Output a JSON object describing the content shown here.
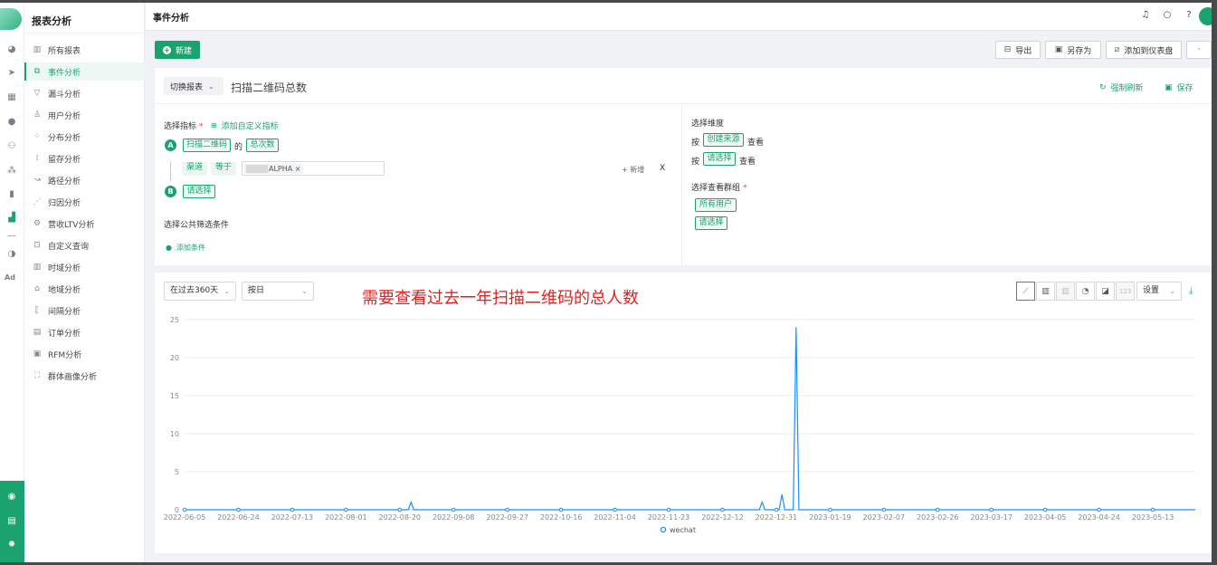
{
  "menu": {
    "title": "报表分析",
    "items": [
      {
        "label": "所有报表",
        "icon": "bar-chart-icon"
      },
      {
        "label": "事件分析",
        "icon": "event-icon"
      },
      {
        "label": "漏斗分析",
        "icon": "funnel-icon"
      },
      {
        "label": "用户分析",
        "icon": "user-icon"
      },
      {
        "label": "分布分析",
        "icon": "distribution-icon"
      },
      {
        "label": "留存分析",
        "icon": "retention-icon"
      },
      {
        "label": "路径分析",
        "icon": "path-icon"
      },
      {
        "label": "归因分析",
        "icon": "attribution-icon"
      },
      {
        "label": "营收LTV分析",
        "icon": "revenue-icon"
      },
      {
        "label": "自定义查询",
        "icon": "custom-query-icon"
      },
      {
        "label": "时域分析",
        "icon": "time-icon"
      },
      {
        "label": "地域分析",
        "icon": "map-icon"
      },
      {
        "label": "间隔分析",
        "icon": "interval-icon"
      },
      {
        "label": "订单分析",
        "icon": "order-icon"
      },
      {
        "label": "RFM分析",
        "icon": "rfm-icon"
      },
      {
        "label": "群体画像分析",
        "icon": "persona-icon"
      }
    ]
  },
  "rail": {
    "text_item": "Ad"
  },
  "topbar": {
    "title": "事件分析"
  },
  "toolbar": {
    "new_label": "新建",
    "export_label": "导出",
    "save_as_label": "另存为",
    "add_dashboard_label": "添加到仪表盘"
  },
  "query": {
    "switch_label": "切换报表",
    "report_title": "扫描二维码总数",
    "force_refresh": "强制刷新",
    "save": "保存",
    "select_metric_label": "选择指标",
    "required_mark": "*",
    "add_custom_metric": "添加自定义指标",
    "metric_a": {
      "badge": "A",
      "event": "扫描二维码",
      "of": "的",
      "agg": "总次数"
    },
    "filter": {
      "field": "渠道",
      "op": "等于",
      "value_suffix": "ALPHA",
      "remove": "×",
      "add": "新增",
      "close": "X"
    },
    "metric_b": {
      "badge": "B",
      "placeholder": "请选择"
    },
    "public_filter_label": "选择公共筛选条件",
    "add_condition": "添加条件",
    "dimension_label": "选择维度",
    "by1": "按",
    "dim1": "创建来源",
    "view1": "查看",
    "by2": "按",
    "dim2": "请选择",
    "view2": "查看",
    "group_label": "选择查看群组",
    "group1": "所有用户",
    "group2": "请选择"
  },
  "chart_controls": {
    "range": "在过去360天",
    "granularity": "按日",
    "settings": "设置",
    "number_view": "123"
  },
  "annotation": "需要查看过去一年扫描二维码的总人数",
  "chart_data": {
    "type": "line",
    "title": "",
    "xlabel": "",
    "ylabel": "",
    "ylim": [
      0,
      25
    ],
    "yticks": [
      0,
      5,
      10,
      15,
      20,
      25
    ],
    "x_start": "2022-06-05",
    "x_end": "2023-05-28",
    "xticks": [
      "2022-06-05",
      "2022-06-24",
      "2022-07-13",
      "2022-08-01",
      "2022-08-20",
      "2022-09-08",
      "2022-09-27",
      "2022-10-16",
      "2022-11-04",
      "2022-11-23",
      "2022-12-12",
      "2022-12-31",
      "2023-01-19",
      "2023-02-07",
      "2023-02-26",
      "2023-03-17",
      "2023-04-05",
      "2023-04-24",
      "2023-05-13"
    ],
    "series": [
      {
        "name": "wechat",
        "color": "#1890ff",
        "points": [
          {
            "x": "2022-06-05",
            "y": 0
          },
          {
            "x": "2022-08-23",
            "y": 0
          },
          {
            "x": "2022-08-24",
            "y": 1
          },
          {
            "x": "2022-08-25",
            "y": 0
          },
          {
            "x": "2022-12-25",
            "y": 0
          },
          {
            "x": "2022-12-26",
            "y": 1
          },
          {
            "x": "2022-12-27",
            "y": 0
          },
          {
            "x": "2023-01-01",
            "y": 0
          },
          {
            "x": "2023-01-02",
            "y": 2
          },
          {
            "x": "2023-01-03",
            "y": 0
          },
          {
            "x": "2023-01-06",
            "y": 0
          },
          {
            "x": "2023-01-07",
            "y": 24
          },
          {
            "x": "2023-01-08",
            "y": 0
          },
          {
            "x": "2023-05-28",
            "y": 0
          }
        ]
      }
    ],
    "grid": true,
    "legend": "bottom-center"
  }
}
